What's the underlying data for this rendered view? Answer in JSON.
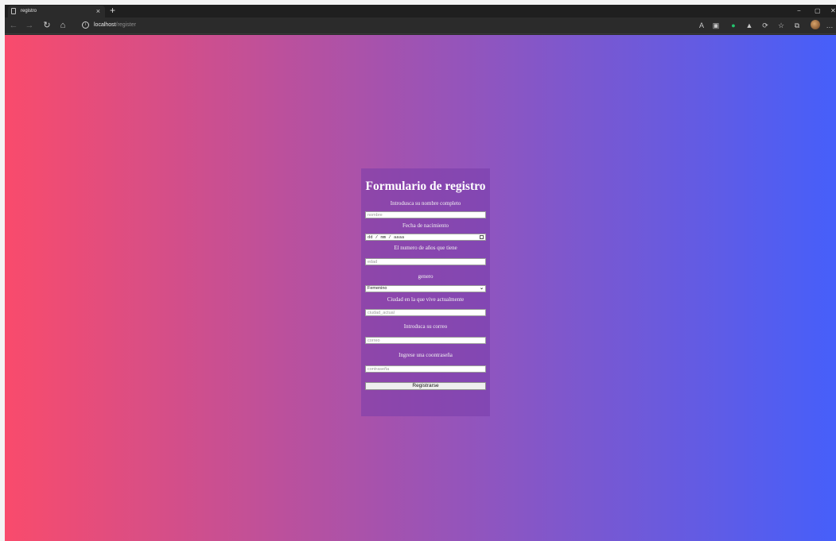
{
  "browser": {
    "tab_title": "registro",
    "tab_close": "×",
    "new_tab": "+",
    "minimize": "−",
    "restore": "▢",
    "close": "✕",
    "url_host": "localhost",
    "url_path": "/register",
    "more": "…"
  },
  "form": {
    "title": "Formulario de registro",
    "name_label": "Introdusca su nombre completo",
    "name_placeholder": "nombre",
    "birth_label": "Fecha de nacimiento",
    "birth_placeholder": "dd / mm / aaaa",
    "age_label": "El numero de años que tiene",
    "age_placeholder": "edad",
    "gender_label": "genero",
    "gender_value": "Femenino",
    "city_label": "Ciudad en la que vive actualmente",
    "city_placeholder": "ciudad_actual",
    "email_label": "Introduca su correo",
    "email_placeholder": "correo",
    "password_label": "Ingrese una coontraseña",
    "password_placeholder": "contraseña",
    "submit_label": "Registrarse"
  },
  "colors": {
    "gradient_left": "#f94b6c",
    "gradient_mid": "#9d53b4",
    "gradient_right": "#465ffa"
  }
}
